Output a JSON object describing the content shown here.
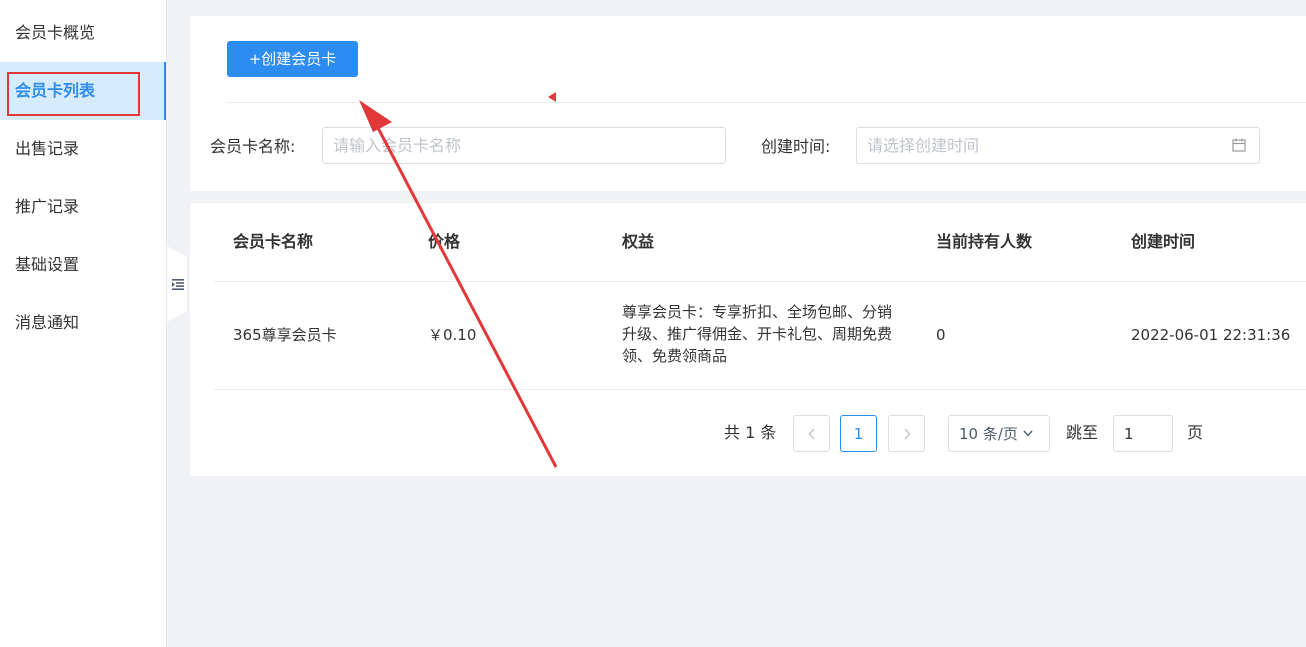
{
  "sidebar": {
    "items": [
      {
        "label": "会员卡概览"
      },
      {
        "label": "会员卡列表"
      },
      {
        "label": "出售记录"
      },
      {
        "label": "推广记录"
      },
      {
        "label": "基础设置"
      },
      {
        "label": "消息通知"
      }
    ],
    "active_index": 1
  },
  "toolbar": {
    "create_label": "+创建会员卡"
  },
  "filters": {
    "name_label": "会员卡名称:",
    "name_placeholder": "请输入会员卡名称",
    "time_label": "创建时间:",
    "time_placeholder": "请选择创建时间"
  },
  "table": {
    "headers": [
      "会员卡名称",
      "价格",
      "权益",
      "当前持有人数",
      "创建时间"
    ],
    "rows": [
      {
        "name": "365尊享会员卡",
        "price": "￥0.10",
        "benefits": "尊享会员卡：专享折扣、全场包邮、分销升级、推广得佣金、开卡礼包、周期免费领、免费领商品",
        "holders": "0",
        "created": "2022-06-01 22:31:36"
      }
    ]
  },
  "pagination": {
    "total_text": "共 1 条",
    "current_page": "1",
    "page_size": "10 条/页",
    "jump_label": "跳至",
    "jump_value": "1",
    "page_suffix": "页"
  },
  "colors": {
    "primary": "#2d8cf0",
    "annotation": "#e3383a",
    "sidebar_active_bg": "#d6ecfd"
  },
  "icons": {
    "collapse": "menu-fold-icon",
    "calendar": "calendar-icon",
    "prev": "chevron-left-icon",
    "next": "chevron-right-icon",
    "dropdown": "chevron-down-icon"
  }
}
